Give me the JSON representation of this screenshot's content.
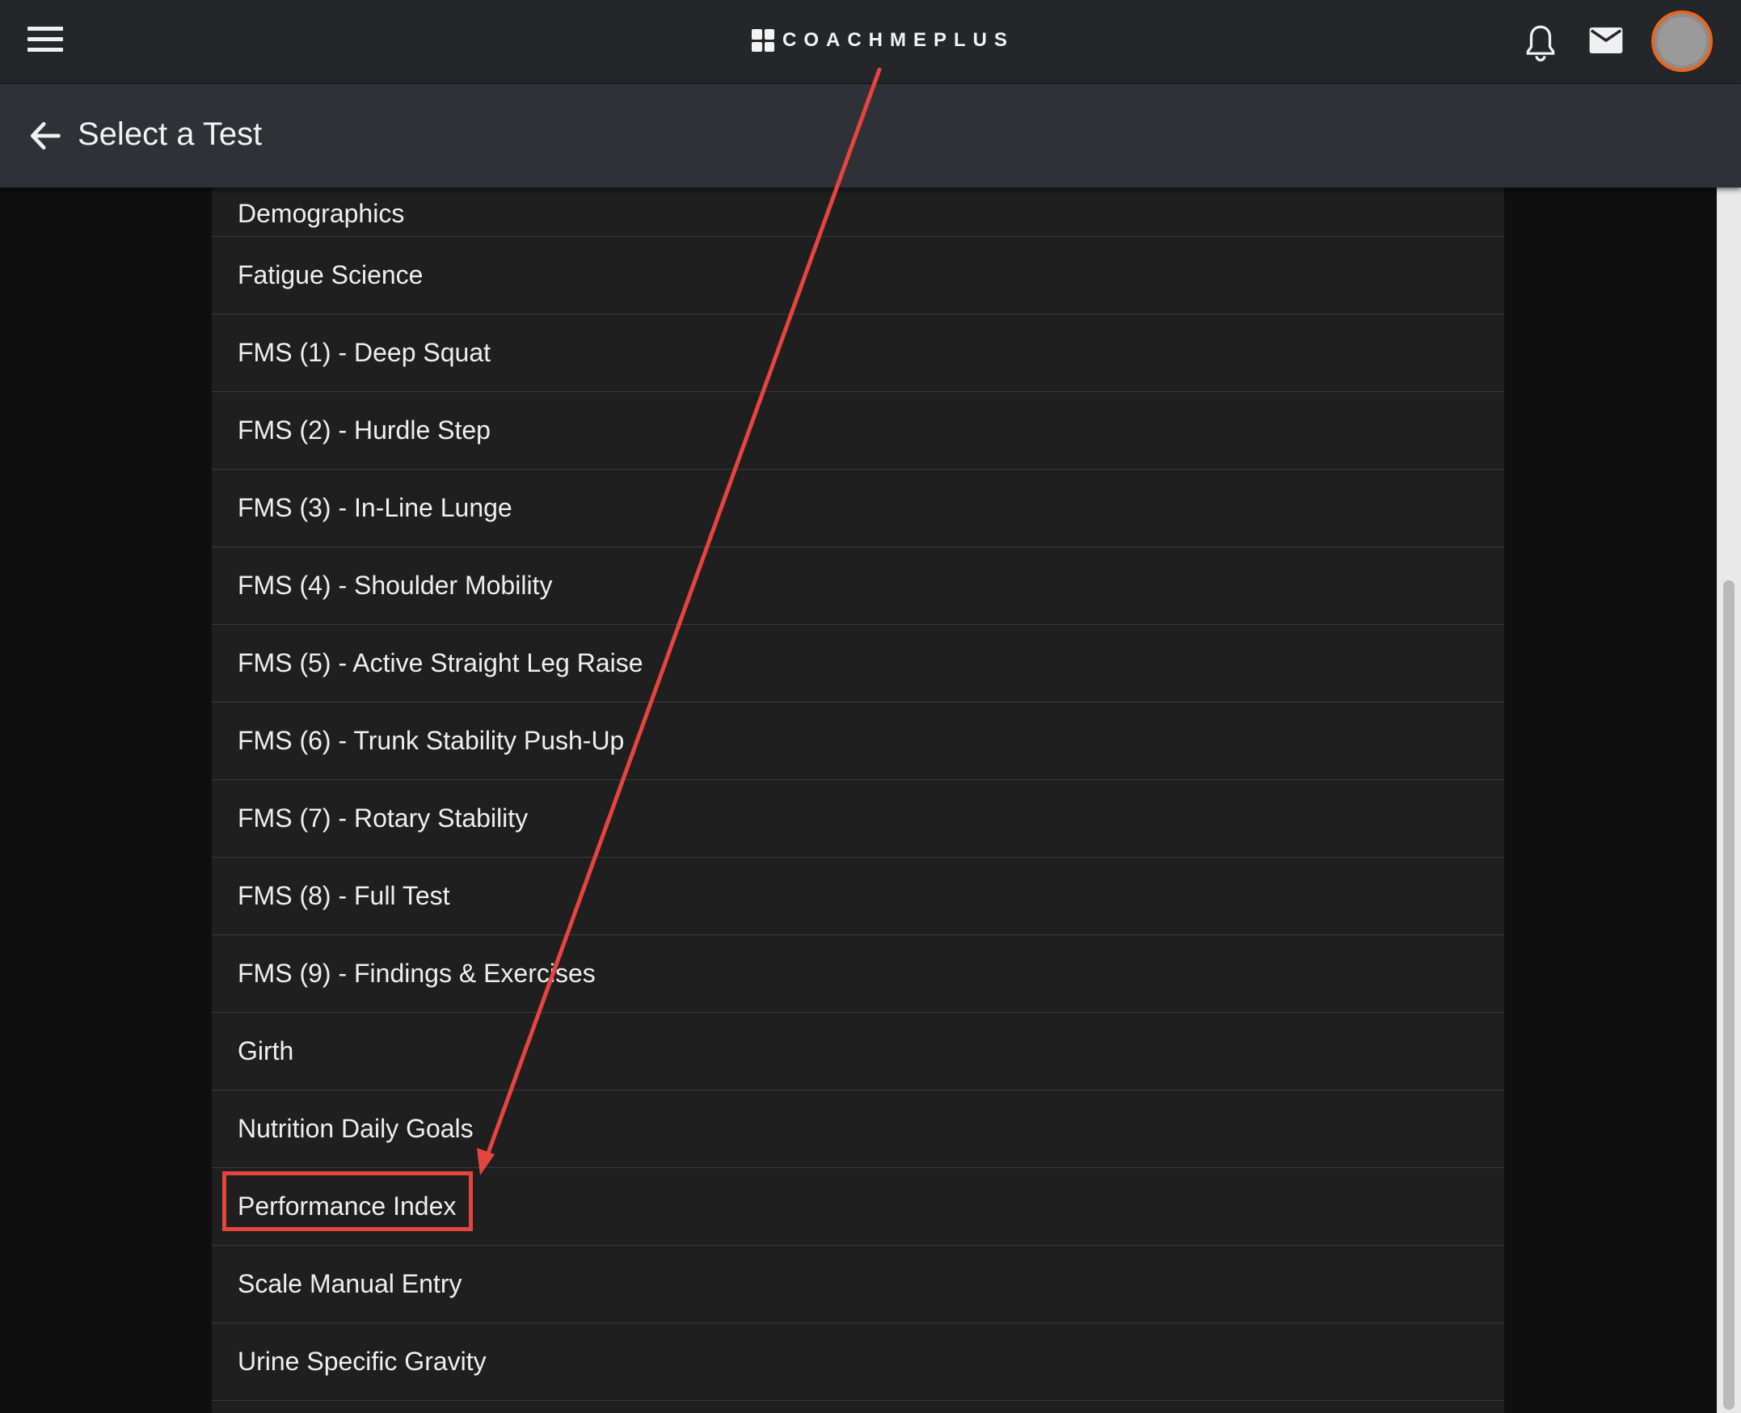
{
  "header": {
    "logo_text": "COACHMEPLUS",
    "menu_icon": "hamburger-menu-icon",
    "notification_icon": "bell-icon",
    "message_icon": "envelope-icon",
    "avatar_border_color": "#e8661f"
  },
  "subheader": {
    "title": "Select a Test",
    "back_icon": "arrow-left-icon"
  },
  "tests": [
    "Demographics",
    "Fatigue Science",
    "FMS (1) - Deep Squat",
    "FMS (2) - Hurdle Step",
    "FMS (3) - In-Line Lunge",
    "FMS (4) - Shoulder Mobility",
    "FMS (5) - Active Straight Leg Raise",
    "FMS (6) - Trunk Stability Push-Up",
    "FMS (7) - Rotary Stability",
    "FMS (8) - Full Test",
    "FMS (9) - Findings & Exercises",
    "Girth",
    "Nutrition Daily Goals",
    "Performance Index",
    "Scale Manual Entry",
    "Urine Specific Gravity"
  ],
  "annotation": {
    "highlighted_item": "Performance Index",
    "color": "#e8443f"
  }
}
